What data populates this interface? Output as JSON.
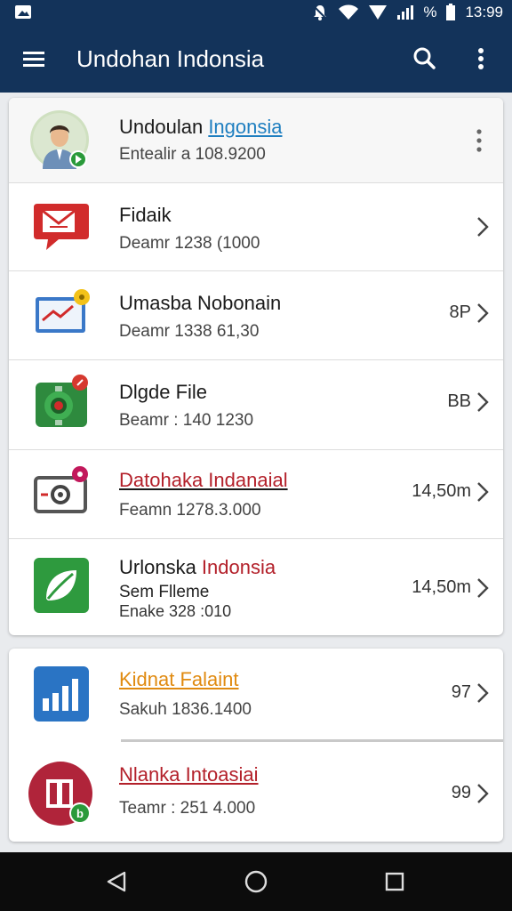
{
  "status_bar": {
    "battery_percent_label": "%",
    "time": "13:99"
  },
  "app_bar": {
    "title": "Undohan Indonsia",
    "menu_icon": "menu-icon",
    "search_icon": "search-icon",
    "more_icon": "more-vert-icon"
  },
  "profile": {
    "name_part1": "Undoulan ",
    "name_part2": "Ingonsia",
    "subtitle": "Entealir a 108.9200",
    "accent": "#1f7fc0"
  },
  "rows": [
    {
      "title": "Fidaik",
      "subtitle": "Deamr 1238 (1000",
      "value": "",
      "icon": "chat-bubble-icon"
    },
    {
      "title": "Umasba Nobonain",
      "subtitle": "Deamr 1338 61,30",
      "value": "8P",
      "icon": "email-chart-icon"
    },
    {
      "title": "Dlgde File",
      "subtitle": "Beamr : 140 1230",
      "value": "BB",
      "icon": "settings-gear-icon"
    },
    {
      "title": "Datohaka Indanaial",
      "subtitle": "Feamn 1278.3.000",
      "value": "14,50m",
      "icon": "camera-icon",
      "title_color": "#b3202a"
    },
    {
      "title_part1": "Urlonska ",
      "title_part2": "Indonsia",
      "subtitle": "Sem Flleme",
      "subtitle2": "Enake 328 :010",
      "value": "14,50m",
      "icon": "leaf-icon",
      "title_color2": "#b3202a"
    }
  ],
  "rows2": [
    {
      "title": "Kidnat Falaint",
      "subtitle": "Sakuh 1836.1400",
      "value": "97",
      "icon": "bar-chart-icon",
      "title_color": "#e08a10"
    },
    {
      "title": "Nlanka Intoasiai",
      "subtitle": "Teamr : 251 4.000",
      "value": "99",
      "icon": "building-icon",
      "title_color": "#b3202a"
    }
  ],
  "nav": {
    "back_icon": "back-triangle-icon",
    "home_icon": "home-circle-icon",
    "recent_icon": "recent-square-icon"
  }
}
